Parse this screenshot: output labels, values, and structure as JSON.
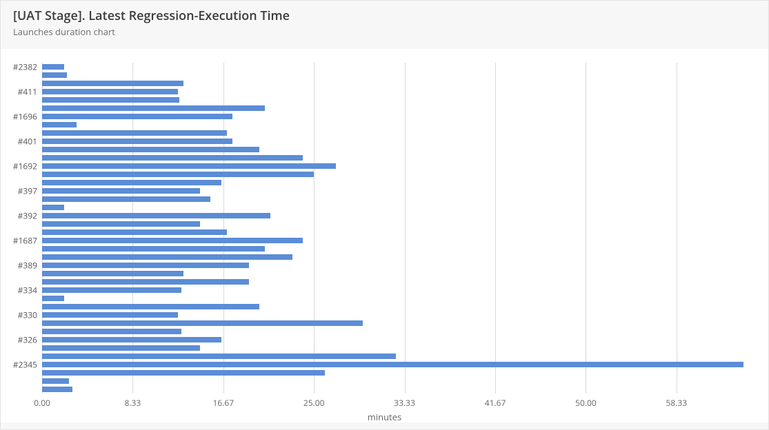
{
  "header": {
    "title": "[UAT Stage]. Latest Regression-Execution Time",
    "subtitle": "Launches duration chart"
  },
  "chart_data": {
    "type": "bar",
    "orientation": "horizontal",
    "xlabel": "minutes",
    "ylabel": "",
    "xlim": [
      0,
      65
    ],
    "x_ticks": [
      0.0,
      8.33,
      16.67,
      25.0,
      33.33,
      41.67,
      50.0,
      58.33
    ],
    "bar_color": "#5b8dd6",
    "y_tick_labels": [
      "#2382",
      "#411",
      "#1696",
      "#401",
      "#1692",
      "#397",
      "#392",
      "#1687",
      "#389",
      "#334",
      "#330",
      "#326",
      "#2345"
    ],
    "y_tick_positions": [
      0,
      3,
      6,
      9,
      12,
      15,
      18,
      21,
      24,
      27,
      30,
      33,
      36
    ],
    "series": [
      {
        "index": 0,
        "value": 2.0
      },
      {
        "index": 1,
        "value": 2.3
      },
      {
        "index": 2,
        "value": 13.0
      },
      {
        "index": 3,
        "value": 12.5
      },
      {
        "index": 4,
        "value": 12.6
      },
      {
        "index": 5,
        "value": 20.5
      },
      {
        "index": 6,
        "value": 17.5
      },
      {
        "index": 7,
        "value": 3.2
      },
      {
        "index": 8,
        "value": 17.0
      },
      {
        "index": 9,
        "value": 17.5
      },
      {
        "index": 10,
        "value": 20.0
      },
      {
        "index": 11,
        "value": 24.0
      },
      {
        "index": 12,
        "value": 27.0
      },
      {
        "index": 13,
        "value": 25.0
      },
      {
        "index": 14,
        "value": 16.5
      },
      {
        "index": 15,
        "value": 14.5
      },
      {
        "index": 16,
        "value": 15.5
      },
      {
        "index": 17,
        "value": 2.0
      },
      {
        "index": 18,
        "value": 21.0
      },
      {
        "index": 19,
        "value": 14.5
      },
      {
        "index": 20,
        "value": 17.0
      },
      {
        "index": 21,
        "value": 24.0
      },
      {
        "index": 22,
        "value": 20.5
      },
      {
        "index": 23,
        "value": 23.0
      },
      {
        "index": 24,
        "value": 19.0
      },
      {
        "index": 25,
        "value": 13.0
      },
      {
        "index": 26,
        "value": 19.0
      },
      {
        "index": 27,
        "value": 12.8
      },
      {
        "index": 28,
        "value": 2.0
      },
      {
        "index": 29,
        "value": 20.0
      },
      {
        "index": 30,
        "value": 12.5
      },
      {
        "index": 31,
        "value": 29.5
      },
      {
        "index": 32,
        "value": 12.8
      },
      {
        "index": 33,
        "value": 16.5
      },
      {
        "index": 34,
        "value": 14.5
      },
      {
        "index": 35,
        "value": 32.5
      },
      {
        "index": 36,
        "value": 64.5
      },
      {
        "index": 37,
        "value": 26.0
      },
      {
        "index": 38,
        "value": 2.5
      },
      {
        "index": 39,
        "value": 2.8
      }
    ]
  }
}
